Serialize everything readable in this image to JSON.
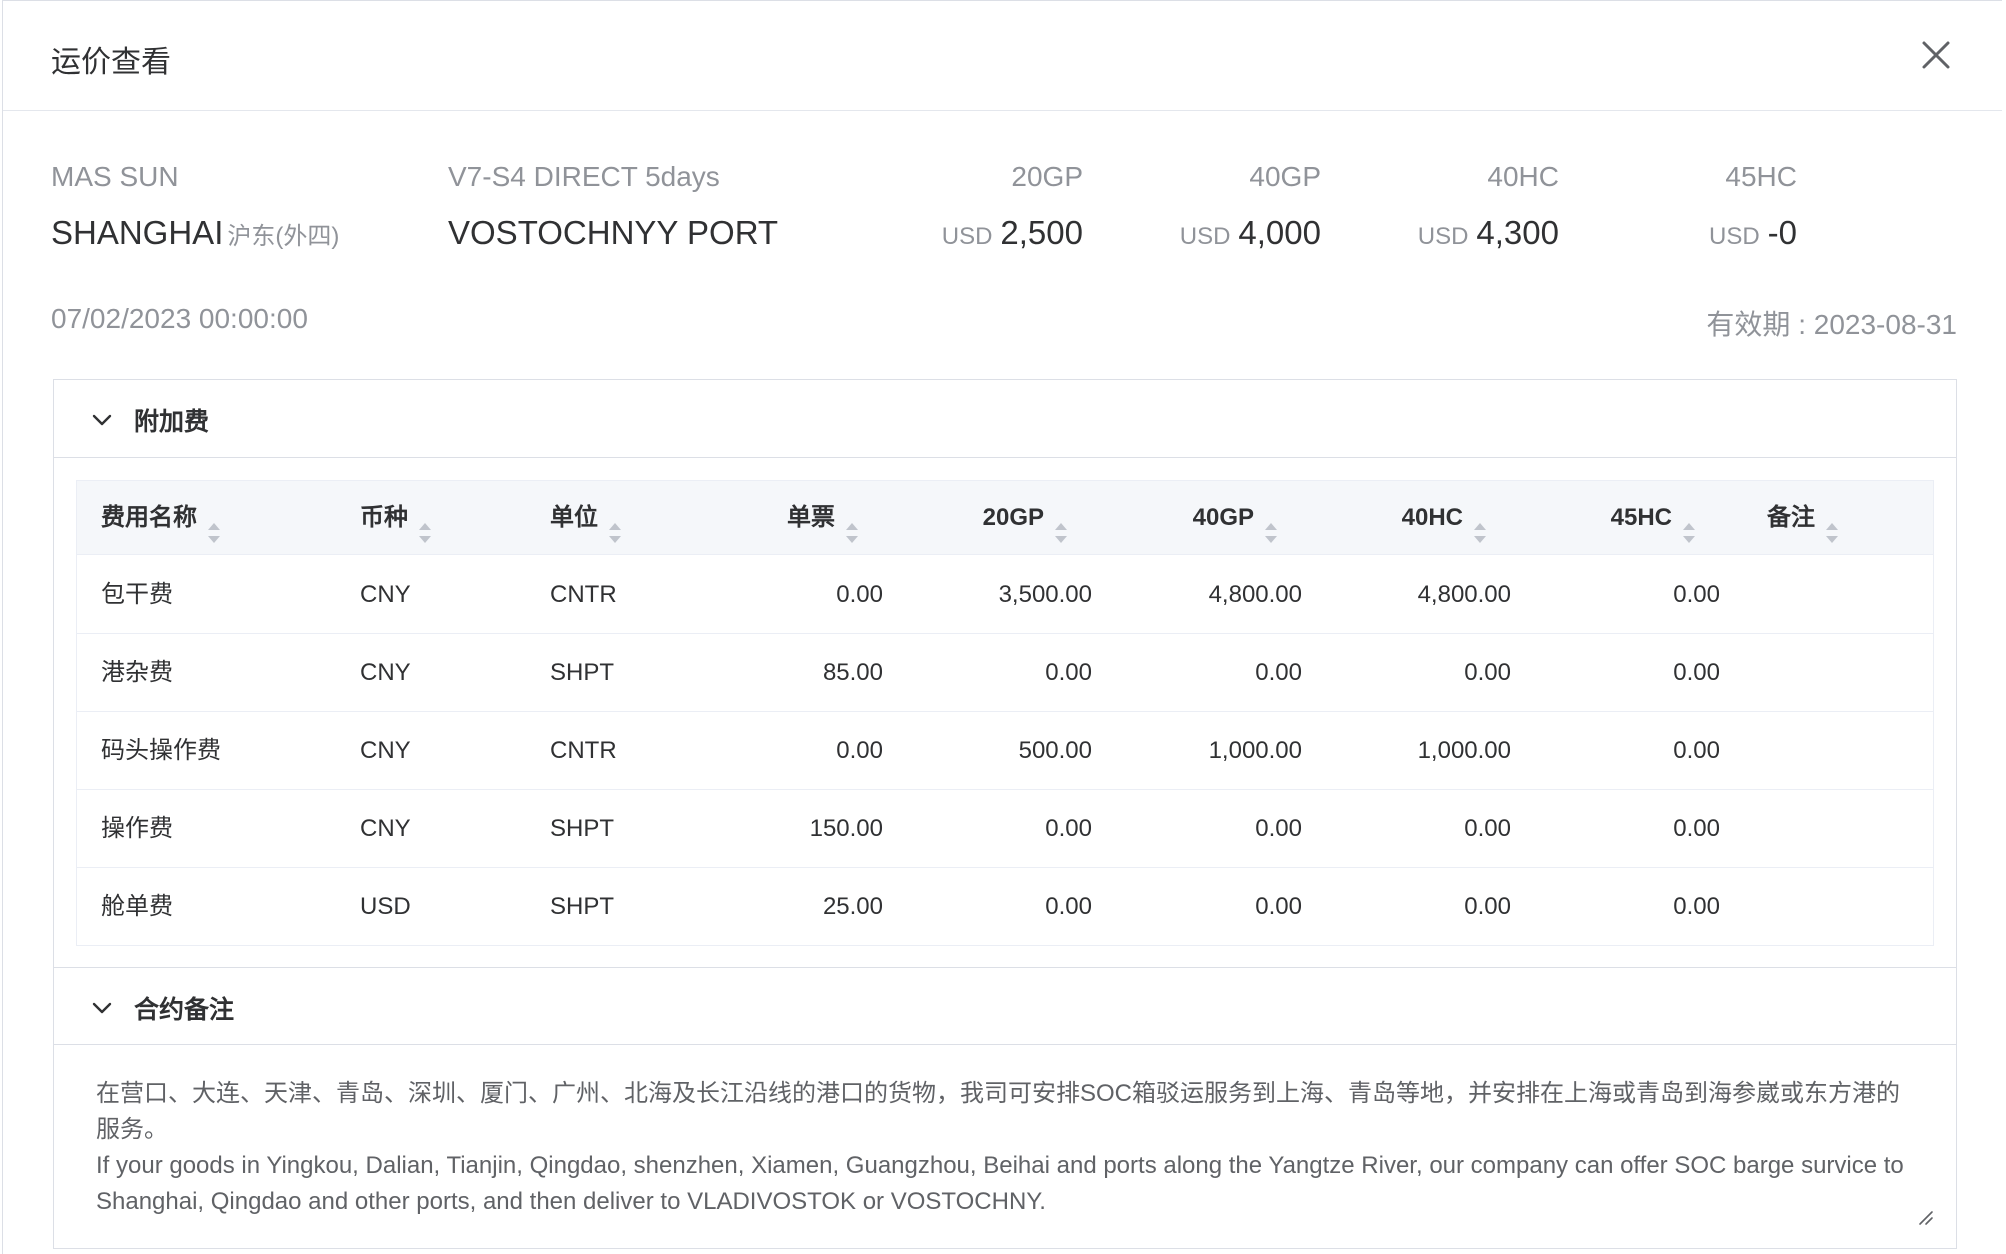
{
  "dialog": {
    "title": "运价查看",
    "close_icon": "close-icon"
  },
  "route": {
    "carrier": "MAS SUN",
    "service": "V7-S4 DIRECT 5days",
    "origin": "SHANGHAI",
    "origin_terminal": "沪东(外四)",
    "destination": "VOSTOCHNYY PORT",
    "date": "07/02/2023 00:00:00",
    "validity": "有效期 : 2023-08-31"
  },
  "prices": [
    {
      "container": "20GP",
      "currency": "USD",
      "amount": "2,500"
    },
    {
      "container": "40GP",
      "currency": "USD",
      "amount": "4,000"
    },
    {
      "container": "40HC",
      "currency": "USD",
      "amount": "4,300"
    },
    {
      "container": "45HC",
      "currency": "USD",
      "amount": "-0"
    }
  ],
  "surcharge": {
    "section_title": "附加费",
    "columns": [
      "费用名称",
      "币种",
      "单位",
      "单票",
      "20GP",
      "40GP",
      "40HC",
      "45HC",
      "备注"
    ],
    "rows": [
      [
        "包干费",
        "CNY",
        "CNTR",
        "0.00",
        "3,500.00",
        "4,800.00",
        "4,800.00",
        "0.00",
        ""
      ],
      [
        "港杂费",
        "CNY",
        "SHPT",
        "85.00",
        "0.00",
        "0.00",
        "0.00",
        "0.00",
        ""
      ],
      [
        "码头操作费",
        "CNY",
        "CNTR",
        "0.00",
        "500.00",
        "1,000.00",
        "1,000.00",
        "0.00",
        ""
      ],
      [
        "操作费",
        "CNY",
        "SHPT",
        "150.00",
        "0.00",
        "0.00",
        "0.00",
        "0.00",
        ""
      ],
      [
        "舱单费",
        "USD",
        "SHPT",
        "25.00",
        "0.00",
        "0.00",
        "0.00",
        "0.00",
        ""
      ]
    ]
  },
  "contract_remark": {
    "section_title": "合约备注",
    "text_cn": "在营口、大连、天津、青岛、深圳、厦门、广州、北海及长江沿线的港口的货物，我司可安排SOC箱驳运服务到上海、青岛等地，并安排在上海或青岛到海参崴或东方港的服务。",
    "text_en": "If your goods in Yingkou, Dalian, Tianjin, Qingdao, shenzhen, Xiamen, Guangzhou, Beihai and ports along the Yangtze River, our company can offer SOC barge survice to Shanghai, Qingdao and other ports, and then deliver to VLADIVOSTOK or VOSTOCHNY."
  },
  "colors": {
    "border": "#dcdfe6",
    "header_bg": "#f5f7fa",
    "muted": "#909399",
    "text": "#303133"
  }
}
